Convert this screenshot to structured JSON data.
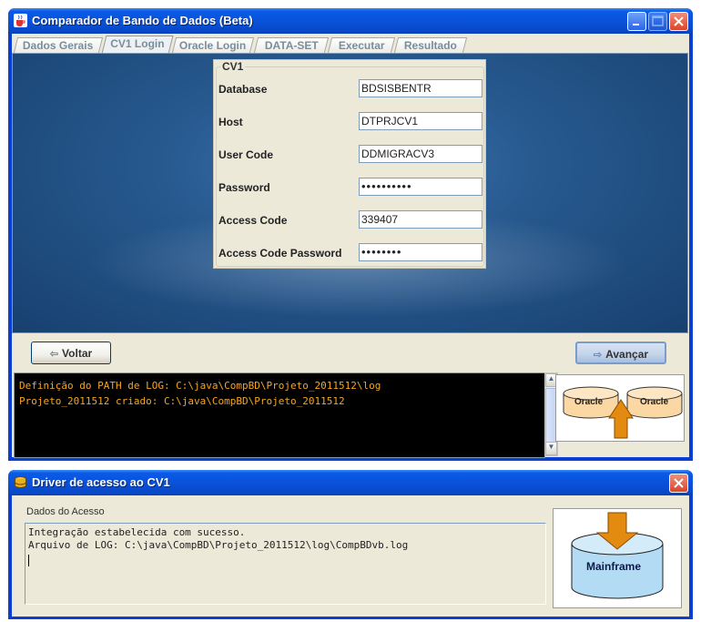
{
  "main_window": {
    "title": "Comparador de Bando de Dados (Beta)",
    "tabs": [
      {
        "label": "Dados Gerais"
      },
      {
        "label": "CV1 Login"
      },
      {
        "label": "Oracle Login"
      },
      {
        "label": "DATA-SET"
      },
      {
        "label": "Executar"
      },
      {
        "label": "Resultado"
      }
    ],
    "active_tab": "CV1 Login",
    "form": {
      "legend": "CV1",
      "fields": [
        {
          "label": "Database",
          "value": "BDSISBENTR"
        },
        {
          "label": "Host",
          "value": "DTPRJCV1"
        },
        {
          "label": "User Code",
          "value": "DDMIGRACV3"
        },
        {
          "label": "Password",
          "value": "••••••••••"
        },
        {
          "label": "Access Code",
          "value": "339407"
        },
        {
          "label": "Access Code Password",
          "value": "••••••••"
        }
      ]
    },
    "back_button": "Voltar",
    "next_button": "Avançar",
    "log_lines": [
      "Definição do PATH de LOG: C:\\java\\CompBD\\Projeto_2011512\\log",
      "Projeto_2011512 criado: C:\\java\\CompBD\\Projeto_2011512"
    ],
    "diagram": {
      "left_db": "Oracle",
      "right_db": "Oracle"
    }
  },
  "driver_window": {
    "title": "Driver de acesso ao CV1",
    "section_label": "Dados do Acesso",
    "lines": [
      "Integração estabelecida com sucesso.",
      "Arquivo de LOG: C:\\java\\CompBD\\Projeto_2011512\\log\\CompBDvb.log"
    ],
    "diagram": {
      "db_label": "Mainframe"
    }
  },
  "colors": {
    "titlebar": "#0a52d9",
    "console_bg": "#000000",
    "console_text": "#f5a623",
    "panel_bg": "#27598f",
    "window_bg": "#ece9d8",
    "arrow": "#e38a10",
    "cylinder": "#fbd7a4",
    "mainframe_cylinder": "#b3dcf4"
  },
  "icons": {
    "app": "java-cup-icon",
    "driver": "database-icon"
  }
}
